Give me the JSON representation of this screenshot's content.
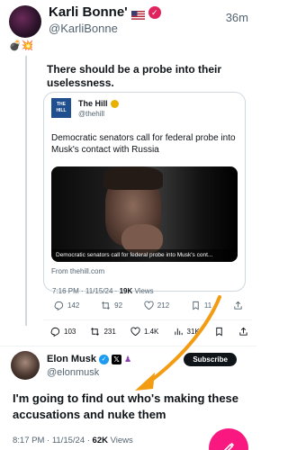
{
  "top_tweet": {
    "display_name": "Karli Bonne'",
    "handle": "@KarliBonne",
    "time": "36m",
    "emoji_line": "💣💥"
  },
  "quote": {
    "text": "There should be a probe into their uselessness."
  },
  "card": {
    "source_name": "The Hill",
    "source_handle": "@thehill",
    "logo_text": "THE HILL",
    "headline": "Democratic senators call for federal probe into Musk's contact with Russia",
    "image_caption": "Democratic senators call for federal probe into Musk's cont...",
    "from": "From thehill.com"
  },
  "quoted_meta": {
    "timestamp": "7:16 PM · 11/15/24 · ",
    "views_count": "19K",
    "views_label": " Views"
  },
  "quoted_actions": {
    "replies": "142",
    "reposts": "92",
    "likes": "212",
    "bookmarks": "11"
  },
  "main_actions": {
    "replies": "103",
    "reposts": "231",
    "likes": "1.4K",
    "views": "31K"
  },
  "elon_tweet": {
    "display_name": "Elon Musk",
    "handle": "@elonmusk",
    "subscribe_label": "Subscribe",
    "text": "I'm going to find out who's making these accusations and nuke them",
    "timestamp": "8:17 PM · 11/15/24 · ",
    "views_count": "62K",
    "views_label": " Views"
  },
  "colors": {
    "accent_pink": "#f91880",
    "verified_blue": "#1d9bf0",
    "arrow_orange": "#f39c12",
    "subscribe_bg": "#0f1419"
  }
}
